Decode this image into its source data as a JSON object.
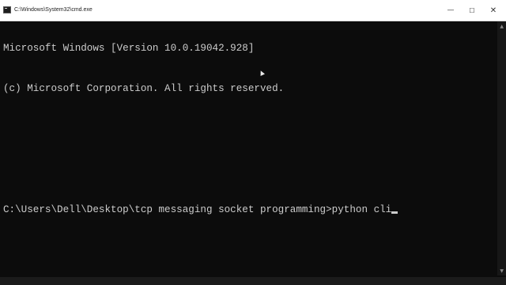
{
  "window": {
    "title": "C:\\Windows\\System32\\cmd.exe",
    "minimize_glyph": "—",
    "maximize_glyph": "☐",
    "close_glyph": "✕"
  },
  "console": {
    "lines": [
      "Microsoft Windows [Version 10.0.19042.928]",
      "(c) Microsoft Corporation. All rights reserved.",
      "",
      "C:\\Users\\Dell\\Desktop\\tcp messaging socket programming>python cli"
    ]
  },
  "icons": {
    "app": "cmd-app-icon",
    "minimize": "minimize-icon",
    "maximize": "maximize-icon",
    "close": "close-icon"
  },
  "colors": {
    "console_bg": "#0c0c0c",
    "console_text": "#cccccc",
    "titlebar_bg": "#ffffff"
  }
}
